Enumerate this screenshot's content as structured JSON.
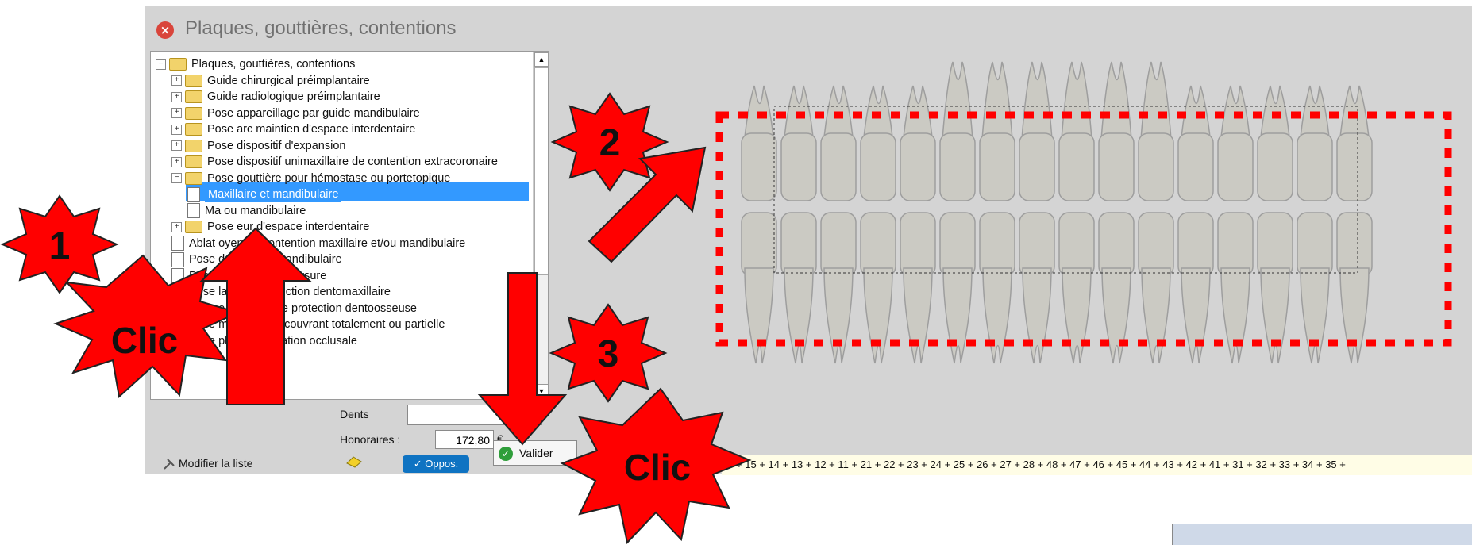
{
  "window": {
    "title": "Plaques, gouttières, contentions"
  },
  "tree": {
    "items": [
      {
        "label": "Plaques, gouttières, contentions",
        "kind": "folder",
        "level": 0,
        "expander": "−"
      },
      {
        "label": "Guide chirurgical préimplantaire",
        "kind": "folder",
        "level": 1,
        "expander": "+"
      },
      {
        "label": "Guide radiologique préimplantaire",
        "kind": "folder",
        "level": 1,
        "expander": "+"
      },
      {
        "label": "Pose appareillage par guide mandibulaire",
        "kind": "folder",
        "level": 1,
        "expander": "+"
      },
      {
        "label": "Pose arc maintien d'espace interdentaire",
        "kind": "folder",
        "level": 1,
        "expander": "+"
      },
      {
        "label": "Pose dispositif d'expansion",
        "kind": "folder",
        "level": 1,
        "expander": "+"
      },
      {
        "label": "Pose dispositif unimaxillaire de contention extracoronaire",
        "kind": "folder",
        "level": 1,
        "expander": "+"
      },
      {
        "label": "Pose gouttière pour hémostase ou portetopique",
        "kind": "folder",
        "level": 1,
        "expander": "−"
      },
      {
        "label": "Maxillaire et mandibulaire",
        "kind": "doc",
        "level": 2,
        "selected": true
      },
      {
        "label": "Ma                 ou mandibulaire",
        "kind": "doc",
        "level": 2
      },
      {
        "label": "Pose            eur d'espace interdentaire",
        "kind": "folder",
        "level": 1,
        "expander": "+"
      },
      {
        "label": "Ablat          oyen de contention maxillaire et/ou mandibulaire",
        "kind": "doc",
        "level": 1
      },
      {
        "label": "Pose              de posture mandibulaire",
        "kind": "doc",
        "level": 1
      },
      {
        "label": "Pose              lage antiautomorsure",
        "kind": "doc",
        "level": 1
      },
      {
        "label": "Pose              lage de protection dentomaxillaire",
        "kind": "doc",
        "level": 1
      },
      {
        "label": "Pose              e plombée de protection dentoosseuse",
        "kind": "doc",
        "level": 1
      },
      {
        "label": "Pose           métallique recouvrant totalement ou partielle",
        "kind": "doc",
        "level": 1
      },
      {
        "label": "Pose plan de libération occlusale",
        "kind": "doc",
        "level": 1
      }
    ]
  },
  "form": {
    "dents_label": "Dents",
    "dents_value": "",
    "honoraires_label": "Honoraires :",
    "honoraires_value": "172,80",
    "currency": "€",
    "valider_label": "Valider",
    "oppos_label": "✓ Oppos.",
    "modifier_label": "Modifier la liste"
  },
  "teeth_footer": "16 + 15 + 14 + 13 + 12 + 11 + 21 + 22 + 23 + 24 + 25 + 26 + 27 + 28 + 48 + 47 + 46 + 45 + 44 + 43 + 42 + 41 + 31 + 32 + 33 + 34 + 35 +",
  "annotations": {
    "step1": "1",
    "step2": "2",
    "step3": "3",
    "clic1": "Clic",
    "clic2": "Clic"
  },
  "colors": {
    "accent_red": "#ff0000",
    "selection_blue": "#3399ff",
    "window_bg": "#d4d4d4"
  }
}
